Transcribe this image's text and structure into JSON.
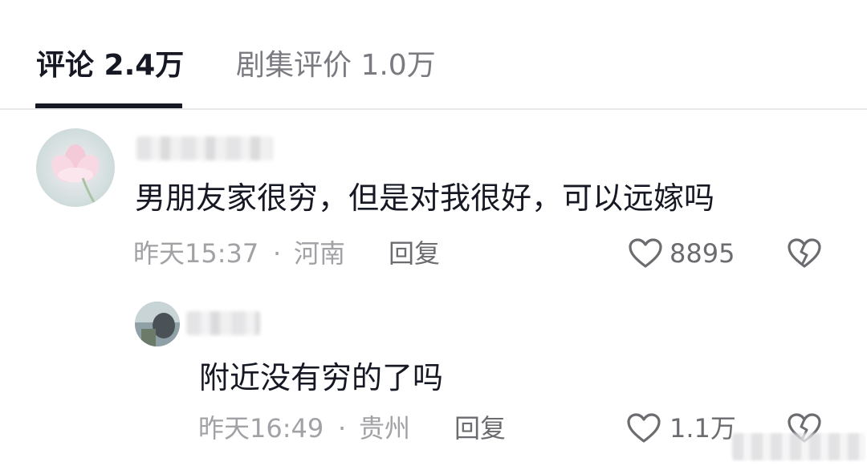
{
  "tabs": [
    {
      "label": "评论 2.4万",
      "active": true
    },
    {
      "label": "剧集评价 1.0万",
      "active": false
    }
  ],
  "comments": [
    {
      "text": "男朋友家很穷，但是对我很好，可以远嫁吗",
      "time": "昨天15:37",
      "separator": "·",
      "location": "河南",
      "reply_label": "回复",
      "likes": "8895"
    },
    {
      "text": "附近没有穷的了吗",
      "time": "昨天16:49",
      "separator": "·",
      "location": "贵州",
      "reply_label": "回复",
      "likes": "1.1万"
    }
  ],
  "icons": {
    "like": "heart-outline-icon",
    "dislike": "broken-heart-icon"
  },
  "colors": {
    "primary_text": "#161823",
    "secondary_text": "#a1a1a6",
    "action_text": "#6b6b70",
    "tab_inactive": "#7a7a80"
  }
}
